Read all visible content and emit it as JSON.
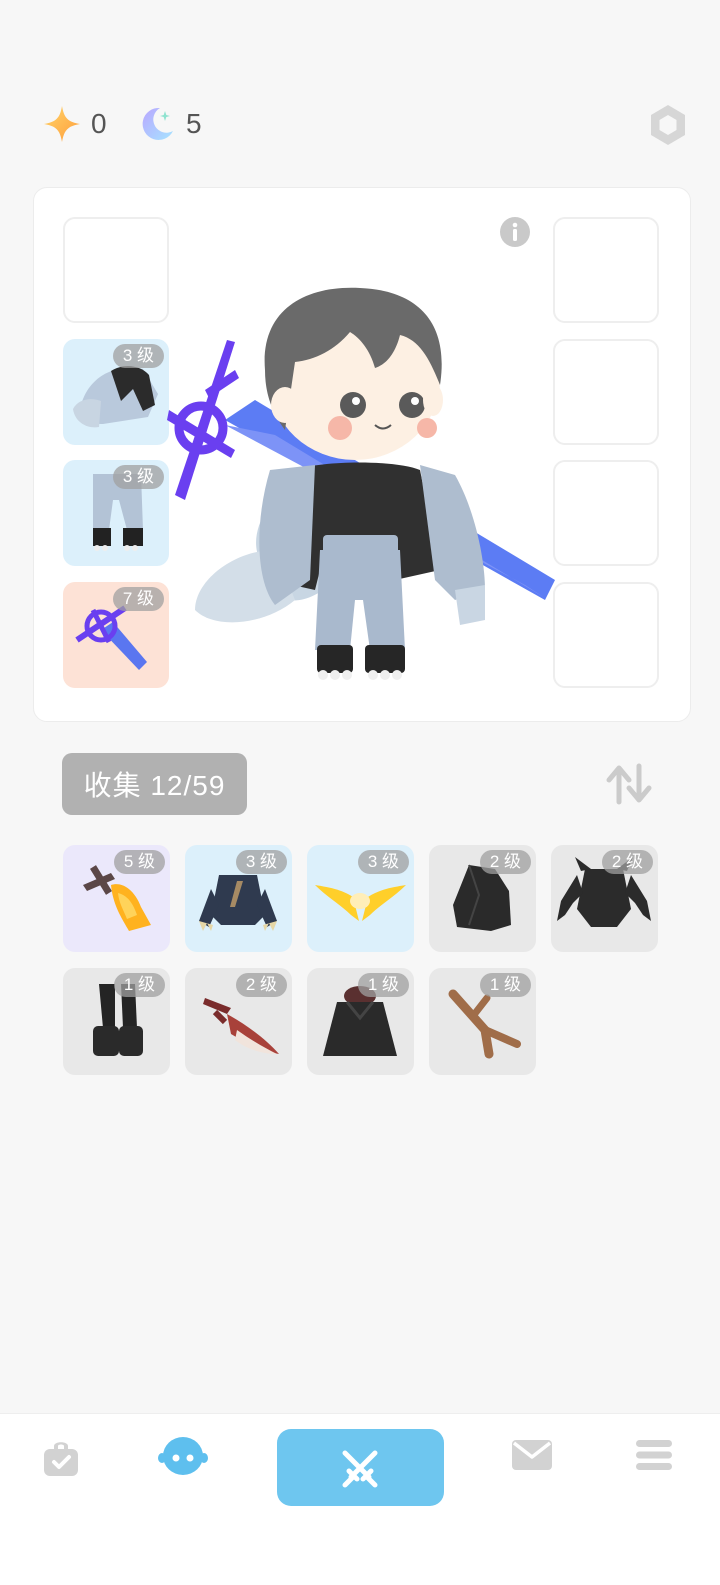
{
  "currencies": [
    {
      "name": "star-currency",
      "icon": "star-icon",
      "value": "0"
    },
    {
      "name": "moon-currency",
      "icon": "moon-star-icon",
      "value": "5"
    }
  ],
  "equipment": {
    "info_icon": "info-icon",
    "left_slots": [
      {
        "state": "empty",
        "level": ""
      },
      {
        "state": "filled",
        "level": "3 级",
        "item": "cape-armor",
        "bg": "#dcf0fb"
      },
      {
        "state": "filled",
        "level": "3 级",
        "item": "leggings",
        "bg": "#dcf0fb"
      },
      {
        "state": "filled",
        "level": "7 级",
        "item": "blue-sword",
        "bg": "#fde2d6"
      }
    ],
    "right_slots": [
      {
        "state": "empty"
      },
      {
        "state": "empty"
      },
      {
        "state": "empty"
      },
      {
        "state": "empty"
      }
    ]
  },
  "collection": {
    "label": "收集 12/59",
    "sort_icon": "sort-arrows-icon",
    "items": [
      {
        "level": "5 级",
        "item": "fire-sword",
        "bg": "#ebe8fb"
      },
      {
        "level": "3 级",
        "item": "dark-blue-armor",
        "bg": "#dcf0fb"
      },
      {
        "level": "3 级",
        "item": "golden-wings",
        "bg": "#dcf0fb"
      },
      {
        "level": "2 级",
        "item": "black-hood",
        "bg": "#e8e8e8"
      },
      {
        "level": "2 级",
        "item": "black-spiked-armor",
        "bg": "#e8e8e8"
      },
      {
        "level": "1 级",
        "item": "black-boots",
        "bg": "#e8e8e8"
      },
      {
        "level": "2 级",
        "item": "red-blade",
        "bg": "#e8e8e8"
      },
      {
        "level": "1 级",
        "item": "black-robe",
        "bg": "#e8e8e8"
      },
      {
        "level": "1 级",
        "item": "wooden-branch",
        "bg": "#e8e8e8"
      }
    ]
  },
  "nav": {
    "items": [
      "bag-icon",
      "character-icon",
      "battle-swords-icon",
      "mail-icon",
      "menu-icon"
    ],
    "active": "battle-swords-icon",
    "accent": "#6ec6ef"
  }
}
